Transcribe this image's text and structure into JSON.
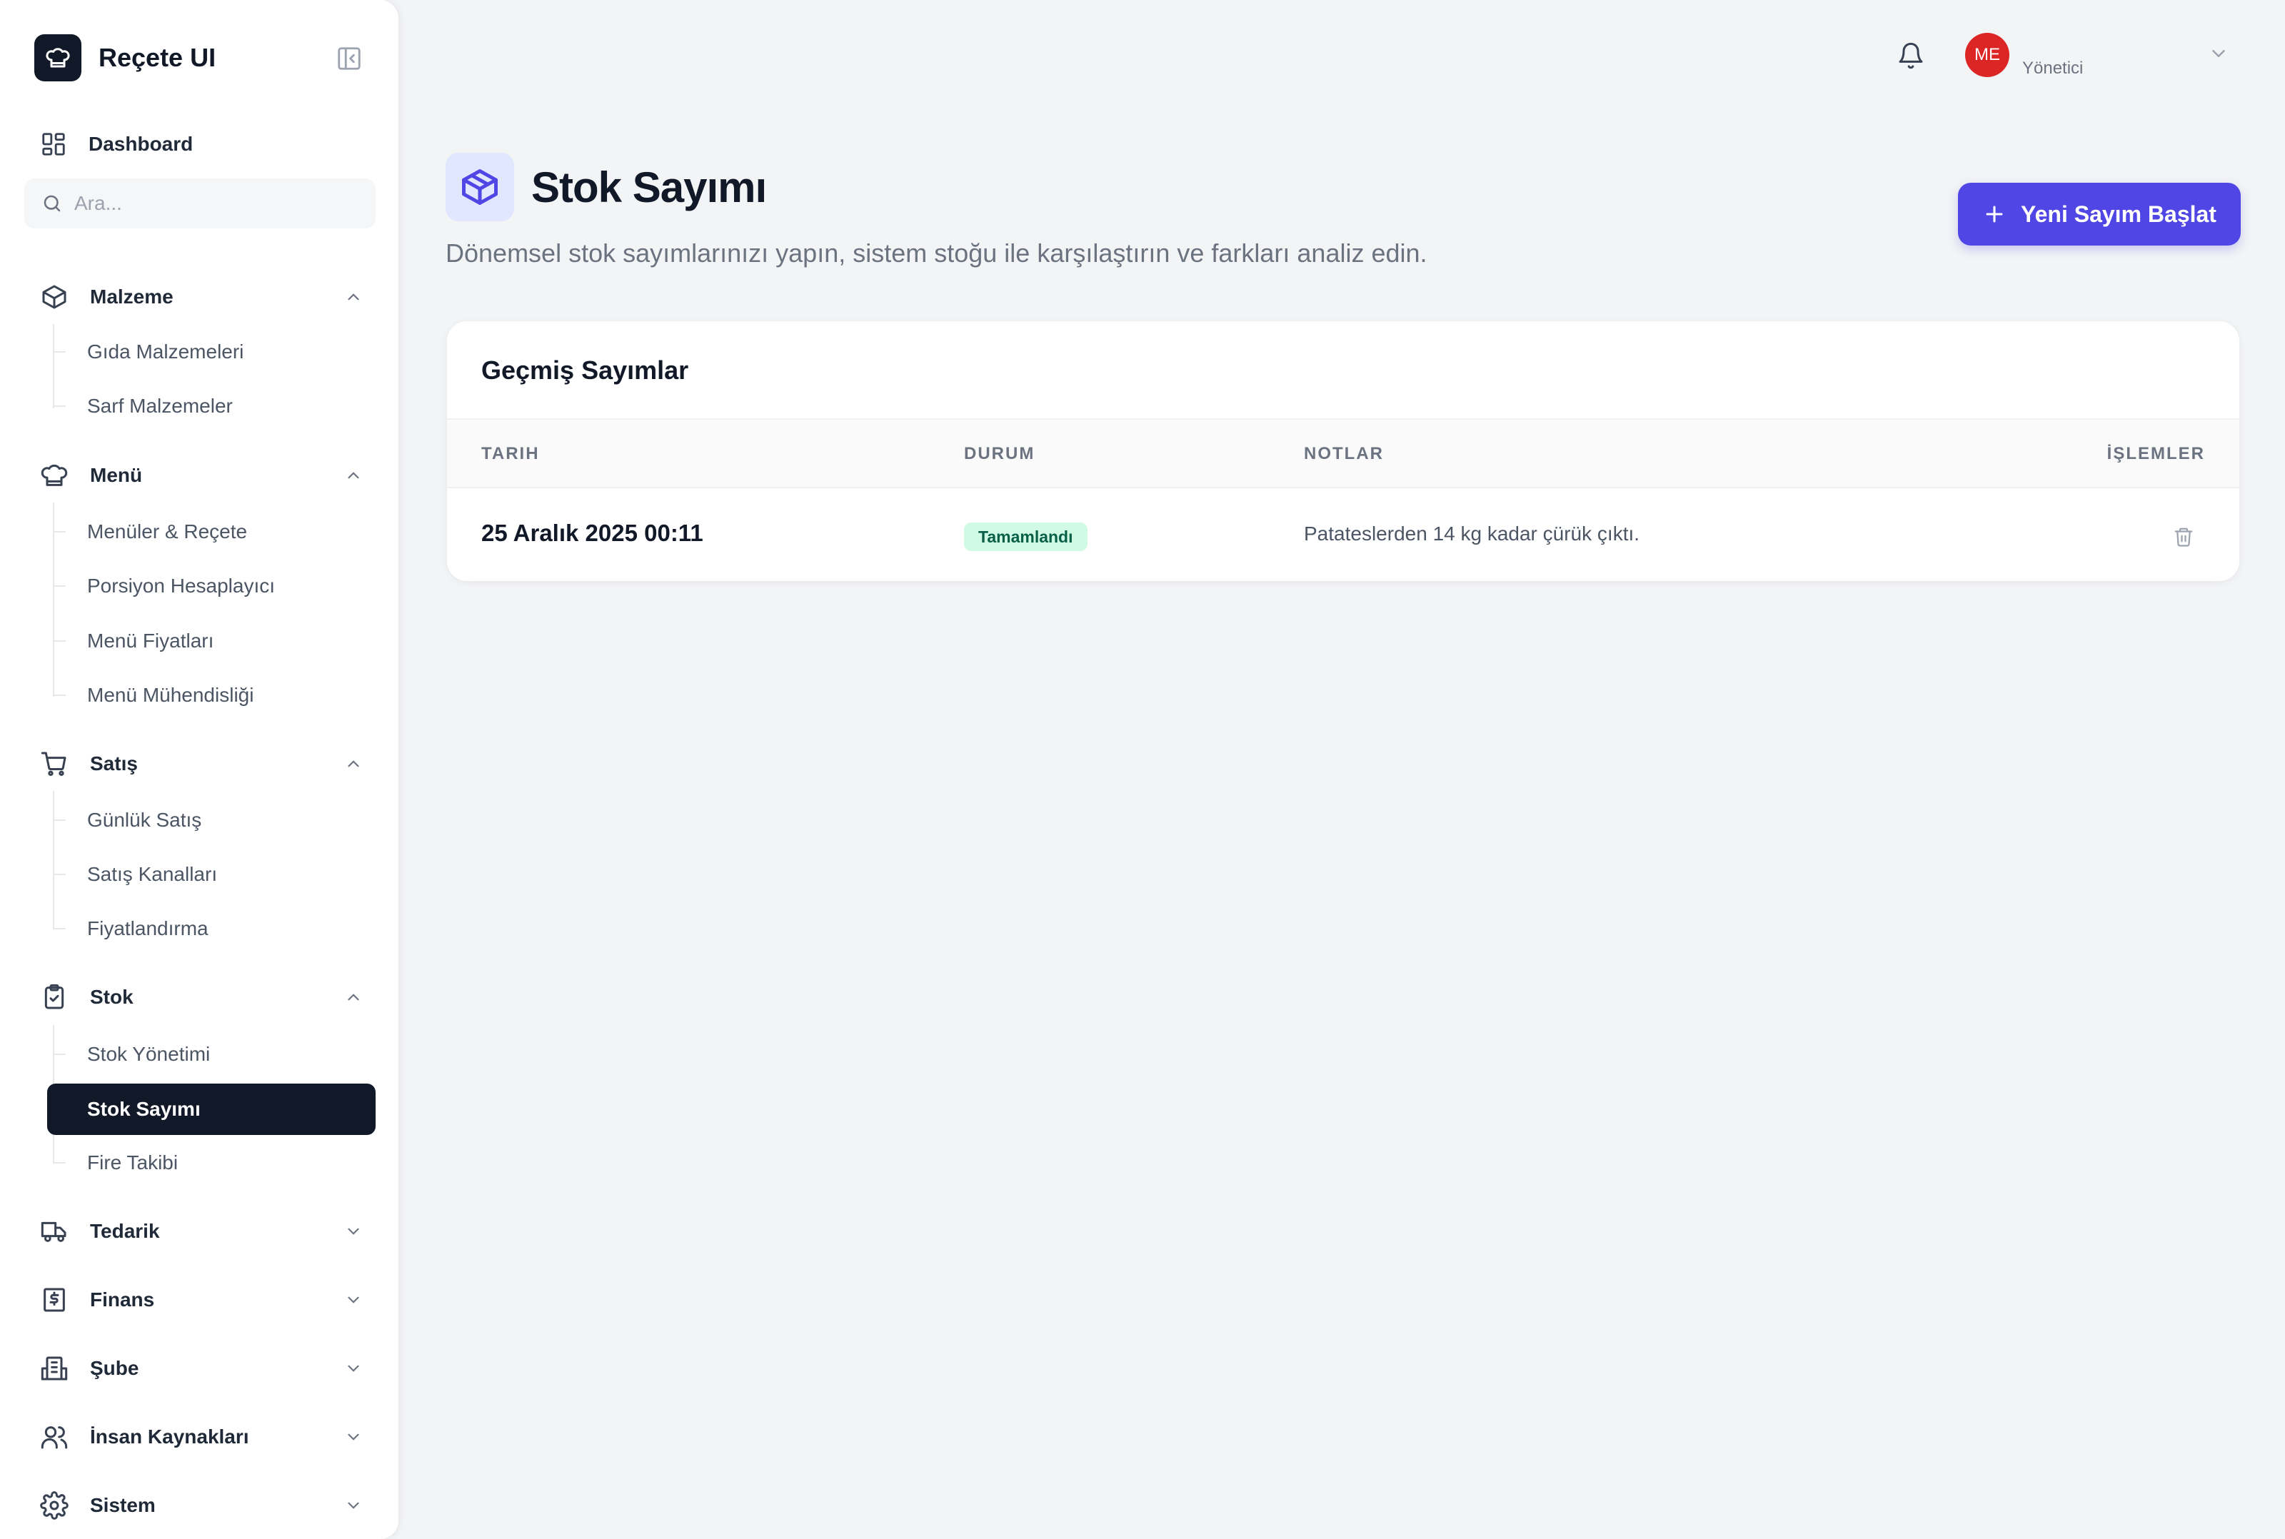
{
  "app": {
    "name": "Reçete UI"
  },
  "sidebar": {
    "dashboard_label": "Dashboard",
    "search_placeholder": "Ara...",
    "sections": [
      {
        "label": "Malzeme",
        "icon": "box-icon",
        "expanded": true,
        "items": [
          "Gıda Malzemeleri",
          "Sarf Malzemeler"
        ]
      },
      {
        "label": "Menü",
        "icon": "chef-hat-icon",
        "expanded": true,
        "items": [
          "Menüler & Reçete",
          "Porsiyon Hesaplayıcı",
          "Menü Fiyatları",
          "Menü Mühendisliği"
        ]
      },
      {
        "label": "Satış",
        "icon": "cart-icon",
        "expanded": true,
        "items": [
          "Günlük Satış",
          "Satış Kanalları",
          "Fiyatlandırma"
        ]
      },
      {
        "label": "Stok",
        "icon": "clipboard-check-icon",
        "expanded": true,
        "items": [
          "Stok Yönetimi",
          "Stok Sayımı",
          "Fire Takibi"
        ]
      },
      {
        "label": "Tedarik",
        "icon": "truck-icon",
        "expanded": false
      },
      {
        "label": "Finans",
        "icon": "dollar-receipt-icon",
        "expanded": false
      },
      {
        "label": "Şube",
        "icon": "building-icon",
        "expanded": false
      },
      {
        "label": "İnsan Kaynakları",
        "icon": "users-icon",
        "expanded": false
      },
      {
        "label": "Sistem",
        "icon": "gear-icon",
        "expanded": false
      }
    ],
    "active_item": "Stok Sayımı"
  },
  "topbar": {
    "user_initials": "ME",
    "user_role": "Yönetici"
  },
  "page": {
    "title": "Stok Sayımı",
    "subtitle": "Dönemsel stok sayımlarınızı yapın, sistem stoğu ile karşılaştırın ve farkları analiz edin.",
    "primary_action": "Yeni Sayım Başlat"
  },
  "history": {
    "title": "Geçmiş Sayımlar",
    "columns": [
      "TARIH",
      "DURUM",
      "NOTLAR",
      "İŞLEMLER"
    ],
    "rows": [
      {
        "date": "25 Aralık 2025 00:11",
        "status": "Tamamlandı",
        "notes": "Patateslerden 14 kg kadar çürük çıktı."
      }
    ]
  },
  "colors": {
    "accent": "#4f46e5",
    "sidebar_active": "#111827",
    "success_badge_bg": "#d1fae5",
    "success_badge_text": "#065f46",
    "avatar": "#dc2626"
  }
}
